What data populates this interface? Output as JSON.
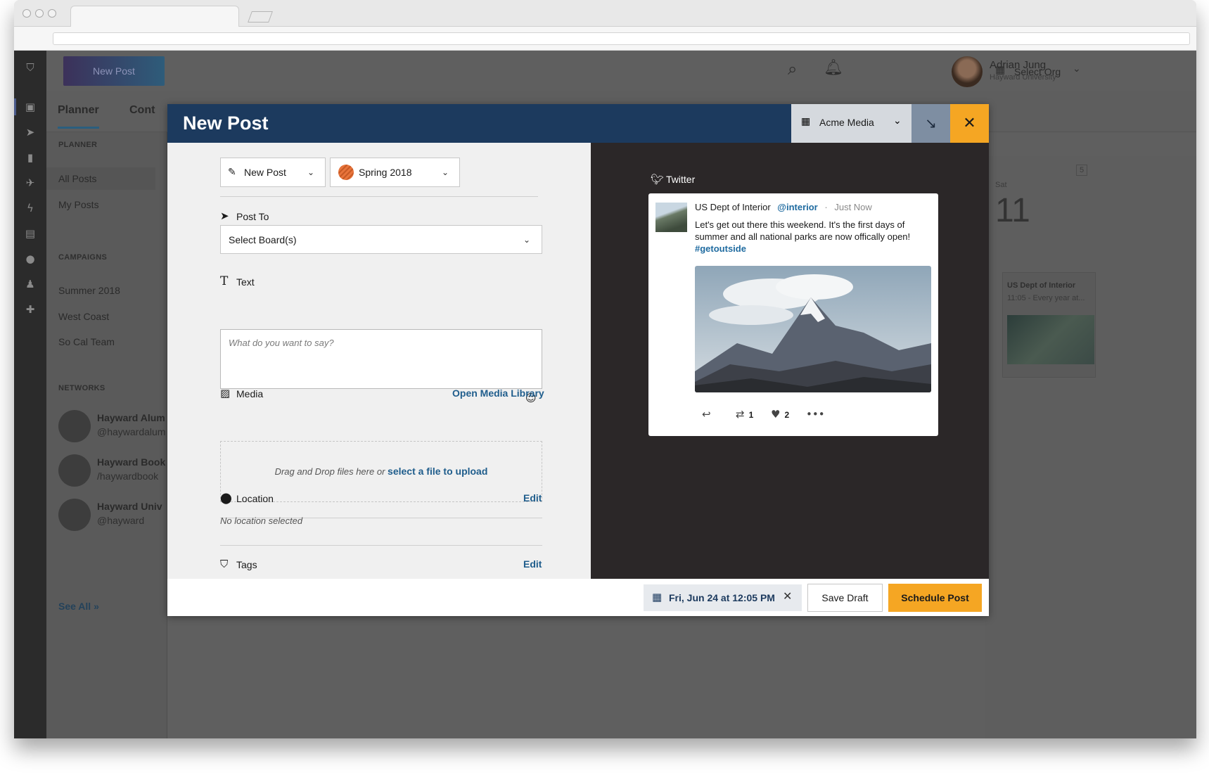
{
  "app": {
    "new_post_button": "New Post",
    "user": {
      "name": "Adrian Jung",
      "org": "Hayward University"
    },
    "select_org": "Select Org",
    "tabs": [
      {
        "label": "Planner"
      },
      {
        "label": "Cont"
      }
    ]
  },
  "sidebar": {
    "planner_heading": "PLANNER",
    "planner_items": [
      {
        "label": "All Posts"
      },
      {
        "label": "My Posts"
      }
    ],
    "campaigns_heading": "CAMPAIGNS",
    "campaign_items": [
      {
        "label": "Summer 2018"
      },
      {
        "label": "West Coast"
      },
      {
        "label": "So Cal Team"
      }
    ],
    "networks_heading": "NETWORKS",
    "networks": [
      {
        "name": "Hayward Alum",
        "handle": "@haywardalum",
        "network_icon": "twitter-icon"
      },
      {
        "name": "Hayward Book",
        "handle": "/haywardbook",
        "network_icon": "facebook-icon"
      },
      {
        "name": "Hayward Univ",
        "handle": "@hayward",
        "network_icon": "instagram-icon"
      }
    ],
    "see_all": "See All"
  },
  "calendar": {
    "weekday": "Sat",
    "day_number": "11",
    "badge": "5",
    "card_title": "US Dept of Interior",
    "card_subtitle": "11:05 - Every year at..."
  },
  "modal": {
    "title": "New Post",
    "org_selector": "Acme Media",
    "post_type": "New Post",
    "campaign": "Spring 2018",
    "post_to_label": "Post To",
    "boards_placeholder": "Select Board(s)",
    "text_label": "Text",
    "text_placeholder": "What do you want to say?",
    "media_label": "Media",
    "open_media_library": "Open Media Library",
    "drop_text": "Drag and Drop files here or",
    "drop_link": "select a file to upload",
    "location_label": "Location",
    "location_edit": "Edit",
    "location_value": "No location selected",
    "tags_label": "Tags",
    "tags_edit": "Edit"
  },
  "preview": {
    "network": "Twitter",
    "tweet": {
      "author": "US Dept of Interior",
      "handle": "@interior",
      "time": "Just Now",
      "text": "Let's get out there this weekend. It's the first days of summer and all national parks are now offically open!",
      "hashtag": "#getoutside",
      "retweets": "1",
      "likes": "2"
    }
  },
  "footer": {
    "scheduled_date": "Fri, Jun 24 at 12:05 PM",
    "save_draft": "Save Draft",
    "schedule_post": "Schedule Post"
  }
}
